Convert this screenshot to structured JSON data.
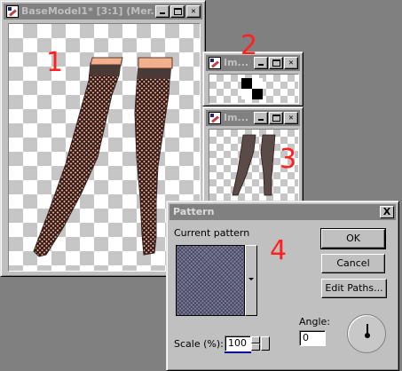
{
  "main_window": {
    "title": "BaseModel1* [3:1] (Mer...",
    "annotation": "1"
  },
  "pattern_window": {
    "title": "Im...",
    "annotation": "2"
  },
  "preview_window": {
    "title": "Im...",
    "annotation": "3"
  },
  "dialog": {
    "title": "Pattern",
    "close_label": "X",
    "annotation": "4",
    "current_pattern_label": "Current pattern",
    "ok_label": "OK",
    "cancel_label": "Cancel",
    "edit_paths_label": "Edit Paths...",
    "angle_label": "Angle:",
    "angle_value": "0",
    "scale_label": "Scale (%):",
    "scale_value": "100"
  },
  "colors": {
    "annotation_red": "#ff2020",
    "inactive_titlebar": "#808080",
    "skin": "#f3b08c",
    "stocking": "#3a2a2a"
  },
  "icons": [
    "app-icon",
    "minimize-icon",
    "maximize-icon",
    "close-icon",
    "dropdown-arrow-icon",
    "spin-up-icon",
    "spin-down-icon",
    "angle-dial-icon"
  ]
}
